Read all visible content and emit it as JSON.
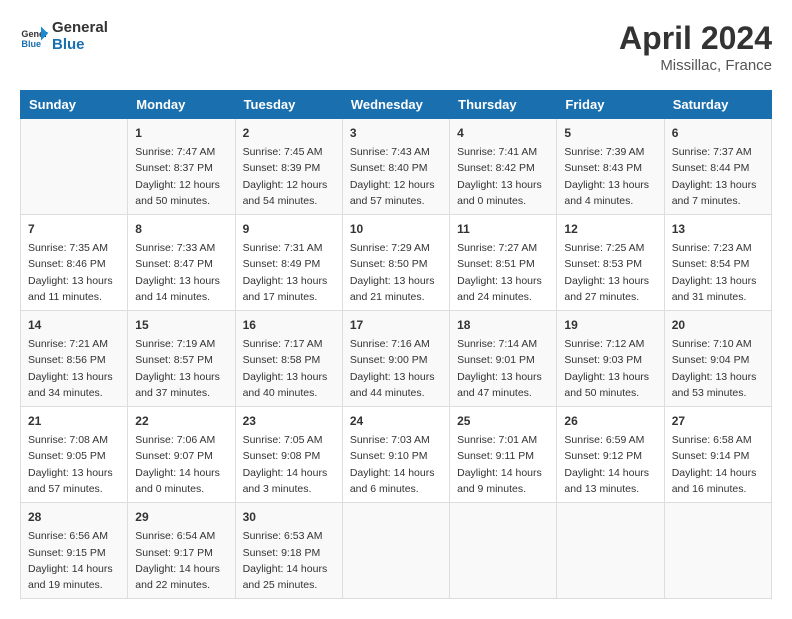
{
  "header": {
    "logo_general": "General",
    "logo_blue": "Blue",
    "month_year": "April 2024",
    "location": "Missillac, France"
  },
  "days_of_week": [
    "Sunday",
    "Monday",
    "Tuesday",
    "Wednesday",
    "Thursday",
    "Friday",
    "Saturday"
  ],
  "weeks": [
    [
      {
        "day": "",
        "text": ""
      },
      {
        "day": "1",
        "text": "Sunrise: 7:47 AM\nSunset: 8:37 PM\nDaylight: 12 hours\nand 50 minutes."
      },
      {
        "day": "2",
        "text": "Sunrise: 7:45 AM\nSunset: 8:39 PM\nDaylight: 12 hours\nand 54 minutes."
      },
      {
        "day": "3",
        "text": "Sunrise: 7:43 AM\nSunset: 8:40 PM\nDaylight: 12 hours\nand 57 minutes."
      },
      {
        "day": "4",
        "text": "Sunrise: 7:41 AM\nSunset: 8:42 PM\nDaylight: 13 hours\nand 0 minutes."
      },
      {
        "day": "5",
        "text": "Sunrise: 7:39 AM\nSunset: 8:43 PM\nDaylight: 13 hours\nand 4 minutes."
      },
      {
        "day": "6",
        "text": "Sunrise: 7:37 AM\nSunset: 8:44 PM\nDaylight: 13 hours\nand 7 minutes."
      }
    ],
    [
      {
        "day": "7",
        "text": "Sunrise: 7:35 AM\nSunset: 8:46 PM\nDaylight: 13 hours\nand 11 minutes."
      },
      {
        "day": "8",
        "text": "Sunrise: 7:33 AM\nSunset: 8:47 PM\nDaylight: 13 hours\nand 14 minutes."
      },
      {
        "day": "9",
        "text": "Sunrise: 7:31 AM\nSunset: 8:49 PM\nDaylight: 13 hours\nand 17 minutes."
      },
      {
        "day": "10",
        "text": "Sunrise: 7:29 AM\nSunset: 8:50 PM\nDaylight: 13 hours\nand 21 minutes."
      },
      {
        "day": "11",
        "text": "Sunrise: 7:27 AM\nSunset: 8:51 PM\nDaylight: 13 hours\nand 24 minutes."
      },
      {
        "day": "12",
        "text": "Sunrise: 7:25 AM\nSunset: 8:53 PM\nDaylight: 13 hours\nand 27 minutes."
      },
      {
        "day": "13",
        "text": "Sunrise: 7:23 AM\nSunset: 8:54 PM\nDaylight: 13 hours\nand 31 minutes."
      }
    ],
    [
      {
        "day": "14",
        "text": "Sunrise: 7:21 AM\nSunset: 8:56 PM\nDaylight: 13 hours\nand 34 minutes."
      },
      {
        "day": "15",
        "text": "Sunrise: 7:19 AM\nSunset: 8:57 PM\nDaylight: 13 hours\nand 37 minutes."
      },
      {
        "day": "16",
        "text": "Sunrise: 7:17 AM\nSunset: 8:58 PM\nDaylight: 13 hours\nand 40 minutes."
      },
      {
        "day": "17",
        "text": "Sunrise: 7:16 AM\nSunset: 9:00 PM\nDaylight: 13 hours\nand 44 minutes."
      },
      {
        "day": "18",
        "text": "Sunrise: 7:14 AM\nSunset: 9:01 PM\nDaylight: 13 hours\nand 47 minutes."
      },
      {
        "day": "19",
        "text": "Sunrise: 7:12 AM\nSunset: 9:03 PM\nDaylight: 13 hours\nand 50 minutes."
      },
      {
        "day": "20",
        "text": "Sunrise: 7:10 AM\nSunset: 9:04 PM\nDaylight: 13 hours\nand 53 minutes."
      }
    ],
    [
      {
        "day": "21",
        "text": "Sunrise: 7:08 AM\nSunset: 9:05 PM\nDaylight: 13 hours\nand 57 minutes."
      },
      {
        "day": "22",
        "text": "Sunrise: 7:06 AM\nSunset: 9:07 PM\nDaylight: 14 hours\nand 0 minutes."
      },
      {
        "day": "23",
        "text": "Sunrise: 7:05 AM\nSunset: 9:08 PM\nDaylight: 14 hours\nand 3 minutes."
      },
      {
        "day": "24",
        "text": "Sunrise: 7:03 AM\nSunset: 9:10 PM\nDaylight: 14 hours\nand 6 minutes."
      },
      {
        "day": "25",
        "text": "Sunrise: 7:01 AM\nSunset: 9:11 PM\nDaylight: 14 hours\nand 9 minutes."
      },
      {
        "day": "26",
        "text": "Sunrise: 6:59 AM\nSunset: 9:12 PM\nDaylight: 14 hours\nand 13 minutes."
      },
      {
        "day": "27",
        "text": "Sunrise: 6:58 AM\nSunset: 9:14 PM\nDaylight: 14 hours\nand 16 minutes."
      }
    ],
    [
      {
        "day": "28",
        "text": "Sunrise: 6:56 AM\nSunset: 9:15 PM\nDaylight: 14 hours\nand 19 minutes."
      },
      {
        "day": "29",
        "text": "Sunrise: 6:54 AM\nSunset: 9:17 PM\nDaylight: 14 hours\nand 22 minutes."
      },
      {
        "day": "30",
        "text": "Sunrise: 6:53 AM\nSunset: 9:18 PM\nDaylight: 14 hours\nand 25 minutes."
      },
      {
        "day": "",
        "text": ""
      },
      {
        "day": "",
        "text": ""
      },
      {
        "day": "",
        "text": ""
      },
      {
        "day": "",
        "text": ""
      }
    ]
  ]
}
